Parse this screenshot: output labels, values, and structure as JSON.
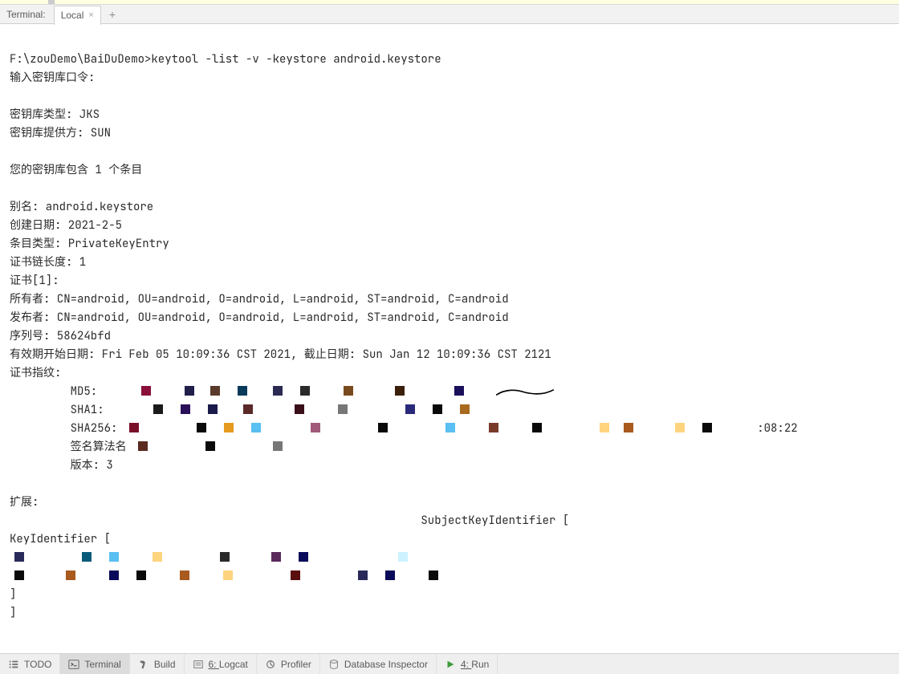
{
  "tabbar": {
    "title": "Terminal:",
    "tab_label": "Local",
    "close": "×",
    "add": "+"
  },
  "terminal": {
    "prompt": "F:\\zouDemo\\BaiDuDemo>keytool -list -v -keystore android.keystore",
    "line_enter_pwd": "输入密钥库口令:",
    "line_ks_type": "密钥库类型: JKS",
    "line_ks_provider": "密钥库提供方: SUN",
    "line_contains": "您的密钥库包含 1 个条目",
    "line_alias": "别名: android.keystore",
    "line_created": "创建日期: 2021-2-5",
    "line_entry_type": "条目类型: PrivateKeyEntry",
    "line_chain_len": "证书链长度: 1",
    "line_cert1": "证书[1]:",
    "line_owner": "所有者: CN=android, OU=android, O=android, L=android, ST=android, C=android",
    "line_issuer": "发布者: CN=android, OU=android, O=android, L=android, ST=android, C=android",
    "line_serial": "序列号: 58624bfd",
    "line_validity": "有效期开始日期: Fri Feb 05 10:09:36 CST 2021, 截止日期: Sun Jan 12 10:09:36 CST 2121",
    "line_fp": "证书指纹:",
    "line_md5": "         MD5: ",
    "line_sha1": "         SHA1:",
    "line_sha256": "         SHA256: ",
    "line_sha256_tail": ":08:22",
    "line_sigalg": "         签名算法名",
    "line_version": "         版本: 3",
    "line_ext": "扩展:",
    "line_subjectkey": "                                                             SubjectKeyIdentifier [",
    "line_keyid": "KeyIdentifier [",
    "line_bracket": "]",
    "redact_row1_colors": [
      "#8a0f3a",
      "#1f1f4a",
      "#5a3a2a",
      "#0a3a5a",
      "#2a2a52",
      "#2a2a2a",
      "#7a4a1f",
      "#3a1f0a",
      "#1a0f5a"
    ],
    "redact_row2_colors": [
      "#1a1a1a",
      "#2a0f5a",
      "#1a1a4a",
      "#5a2a2a",
      "#3a0f1a",
      "#777777",
      "#2a2a7a",
      "#0a0a0a",
      "#a86a1f"
    ],
    "redact_row3_colors": [
      "#7a0f2a",
      "#0a0a0a",
      "#e69a1f",
      "#5abff2",
      "#a05a7a",
      "#0a0a0a",
      "#5abff2",
      "#7a3a2a",
      "#0a0a0a",
      "#ffd47f",
      "#a85a1f",
      "#ffd47f",
      "#0a0a0a"
    ],
    "redact_row4_colors": [
      "#5a2a1f",
      "#0a0a0a",
      "#777777"
    ],
    "redact_row5_colors": [
      "#2a2a5a",
      "#0a5a7a",
      "#5abff2",
      "#ffd47f",
      "#2a2a2a",
      "#5a2a5a",
      "#0a0a5a",
      "#ccf2ff"
    ],
    "redact_row6_colors": [
      "#0a0a0a",
      "#a85a1f",
      "#0a0a5a",
      "#0a0a0a",
      "#a85a1f",
      "#ffd47f",
      "#5a0f0f",
      "#2a2a5a",
      "#0a0a5a",
      "#0a0a0a"
    ]
  },
  "bottombar": {
    "todo": "TODO",
    "terminal": "Terminal",
    "build": "Build",
    "logcat": "Logcat",
    "logcat_prefix": "6: ",
    "profiler": "Profiler",
    "dbinspector": "Database Inspector",
    "run": "Run",
    "run_prefix": "4: "
  }
}
